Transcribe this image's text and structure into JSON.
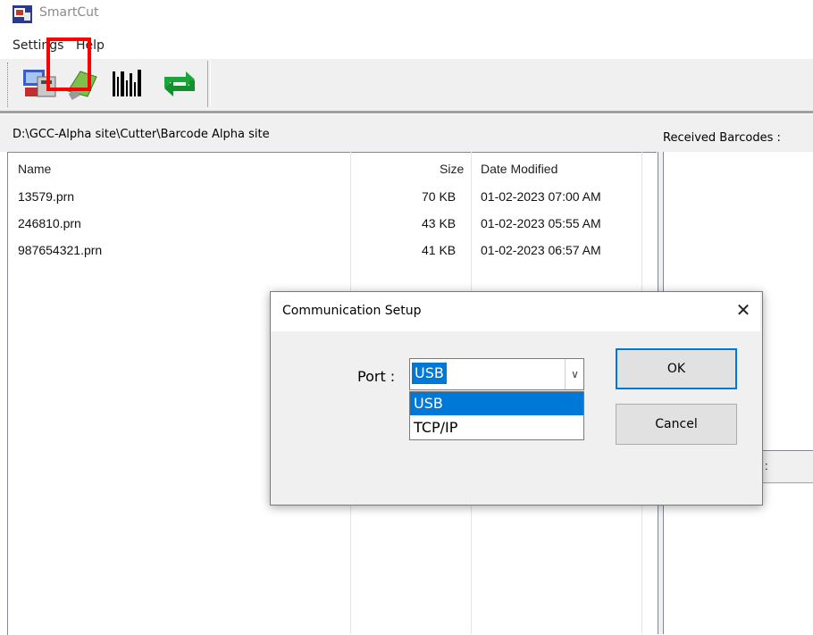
{
  "window": {
    "title": "SmartCut"
  },
  "menu": {
    "items": [
      "Settings",
      "Help"
    ]
  },
  "toolbar": {
    "buttons": [
      "connect-icon",
      "send-icon",
      "barcode-icon",
      "refresh-icon"
    ]
  },
  "path": "D:\\GCC-Alpha site\\Cutter\\Barcode Alpha site",
  "received_barcodes_label": "Received Barcodes :",
  "file_list": {
    "columns": {
      "name": "Name",
      "size": "Size",
      "date": "Date Modified"
    },
    "rows": [
      {
        "name": "13579.prn",
        "size": "70 KB",
        "date": "01-02-2023 07:00 AM"
      },
      {
        "name": "246810.prn",
        "size": "43 KB",
        "date": "01-02-2023 05:55 AM"
      },
      {
        "name": "987654321.prn",
        "size": "41 KB",
        "date": "01-02-2023 06:57 AM"
      }
    ]
  },
  "right_panel": {
    "partial_label": ":"
  },
  "dialog": {
    "title": "Communication Setup",
    "close": "✕",
    "port_label": "Port :",
    "port_value": "USB",
    "options": [
      "USB",
      "TCP/IP"
    ],
    "ok": "OK",
    "cancel": "Cancel"
  },
  "colors": {
    "selection": "#0078d7",
    "highlight_box": "#ff0000"
  }
}
